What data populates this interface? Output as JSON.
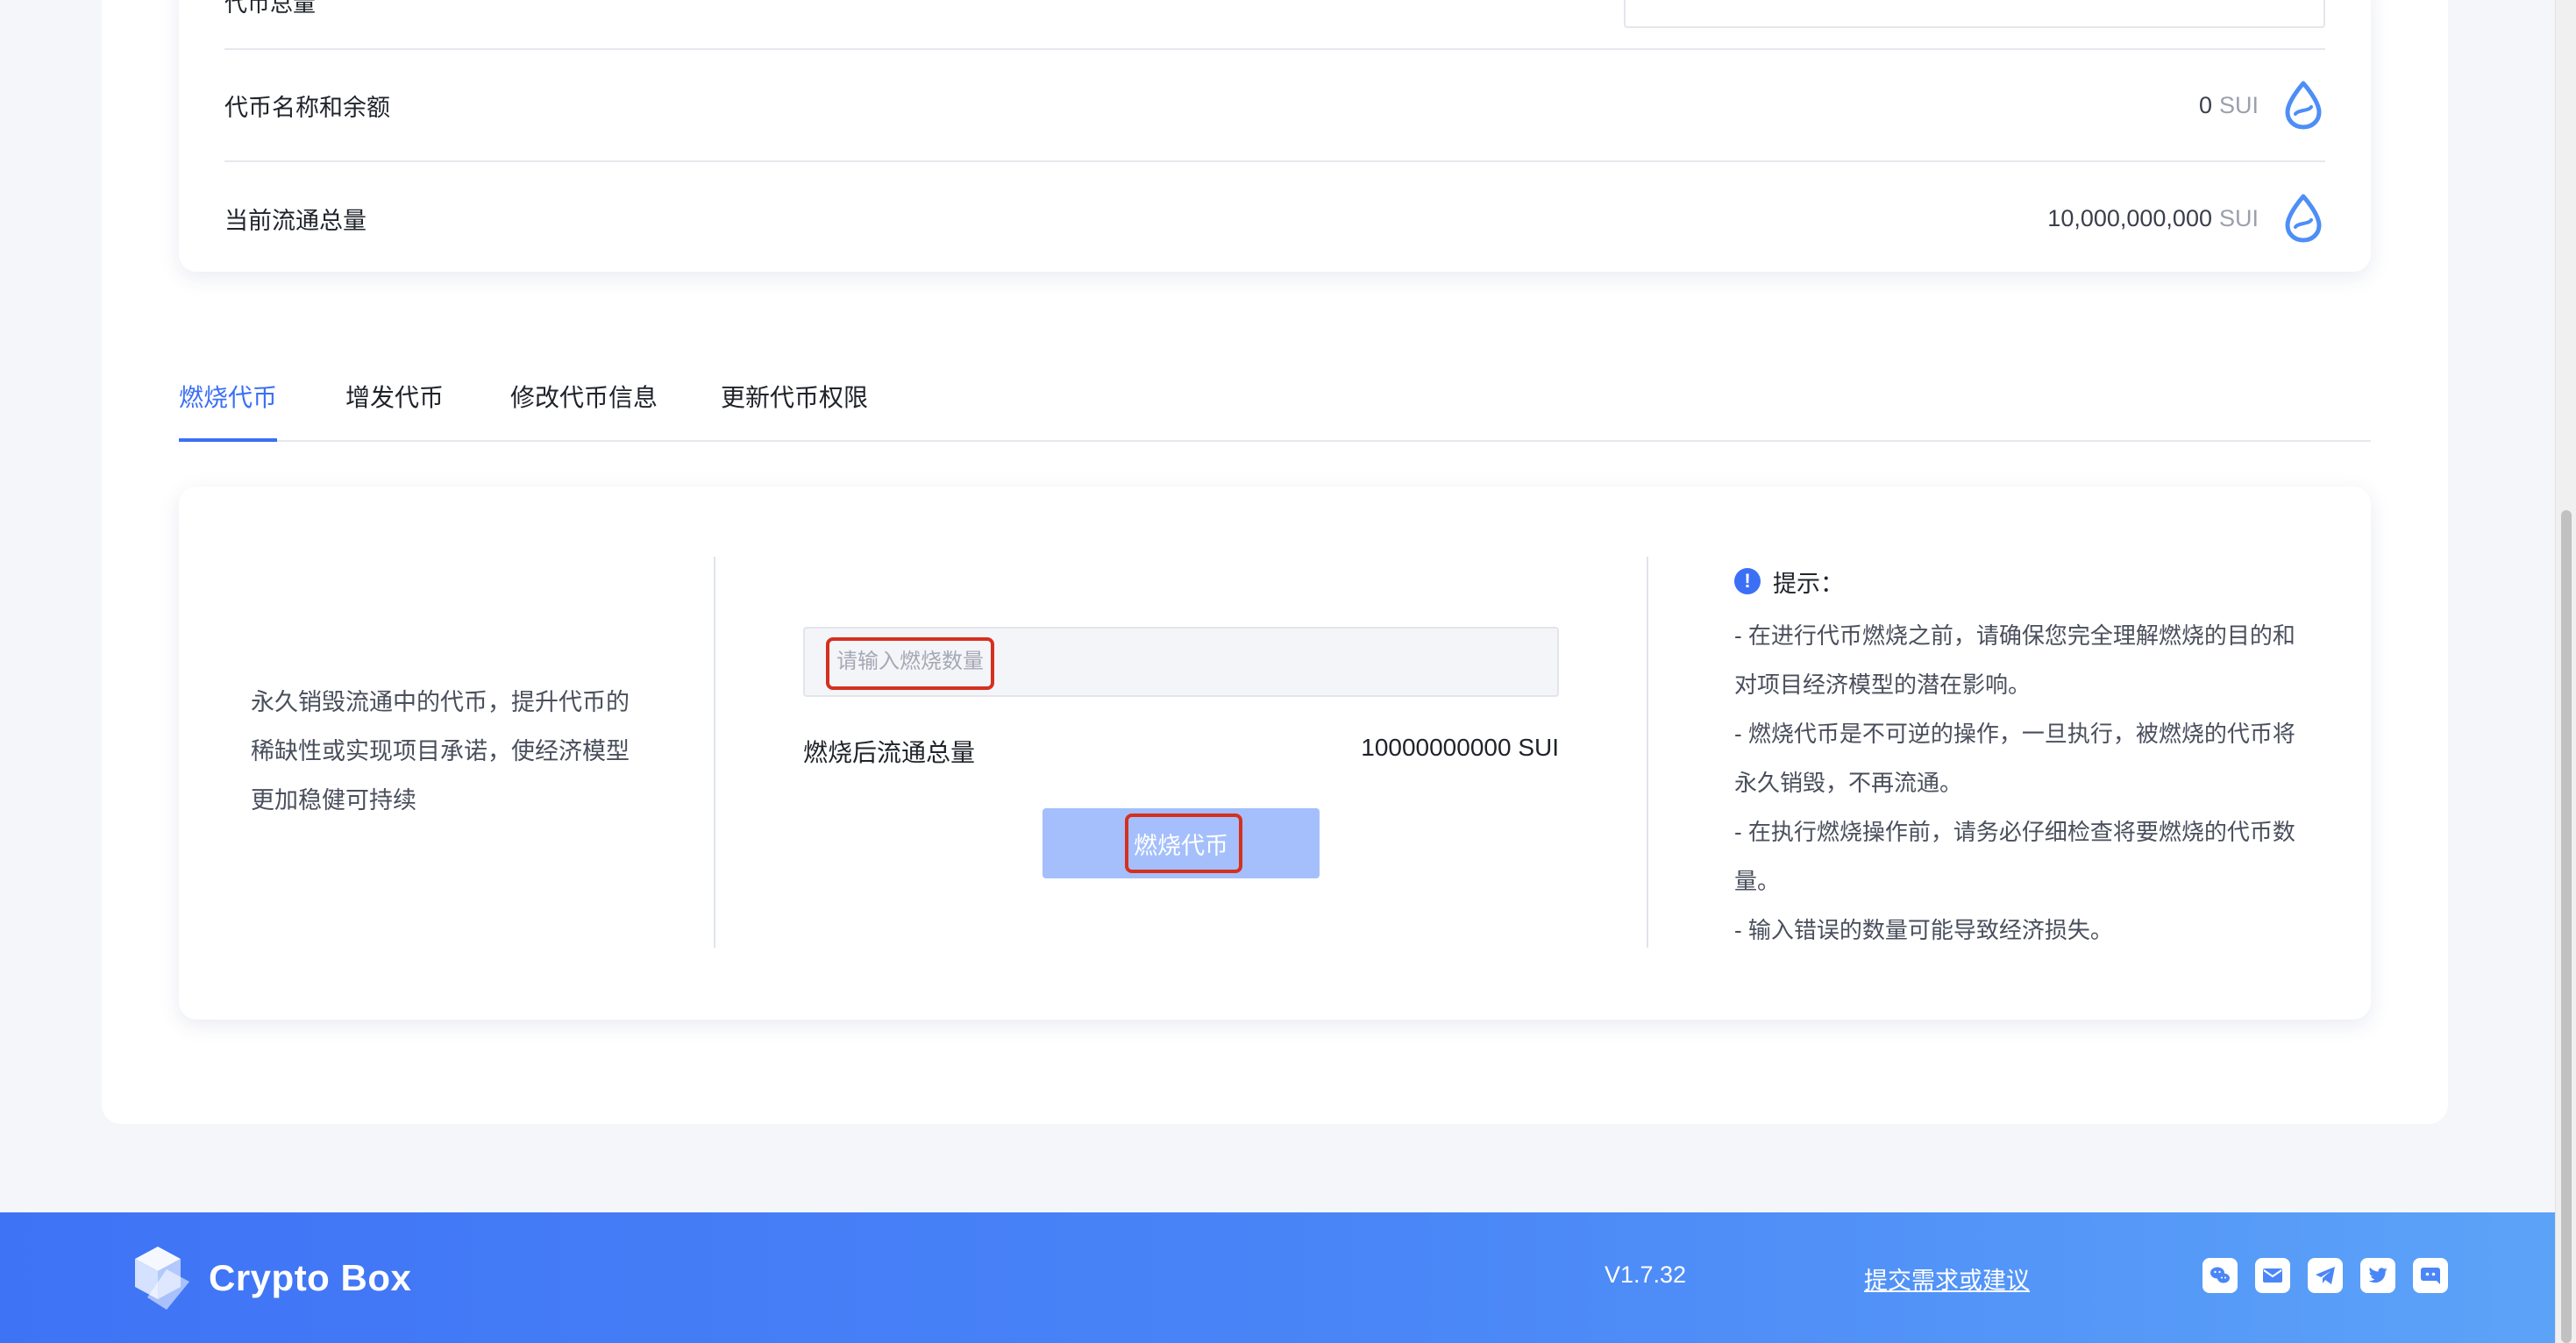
{
  "token_info": {
    "partial_row_label": "代币总量",
    "rows": [
      {
        "label": "代币名称和余额",
        "amount": "0",
        "unit": "SUI"
      },
      {
        "label": "当前流通总量",
        "amount": "10,000,000,000",
        "unit": "SUI"
      }
    ]
  },
  "tabs": [
    {
      "label": "燃烧代币"
    },
    {
      "label": "增发代币"
    },
    {
      "label": "修改代币信息"
    },
    {
      "label": "更新代币权限"
    }
  ],
  "burn_panel": {
    "description": "永久销毁流通中的代币，提升代币的稀缺性或实现项目承诺，使经济模型更加稳健可持续",
    "input_placeholder": "请输入燃烧数量",
    "after_label": "燃烧后流通总量",
    "after_value": "10000000000 SUI",
    "button_label": "燃烧代币",
    "tips_title": "提示：",
    "tips": [
      "- 在进行代币燃烧之前，请确保您完全理解燃烧的目的和对项目经济模型的潜在影响。",
      "- 燃烧代币是不可逆的操作，一旦执行，被燃烧的代币将永久销毁，不再流通。",
      "- 在执行燃烧操作前，请务必仔细检查将要燃烧的代币数量。",
      "- 输入错误的数量可能导致经济损失。"
    ]
  },
  "footer": {
    "brand": "Crypto Box",
    "version": "V1.7.32",
    "feedback_link": "提交需求或建议",
    "social_icons": [
      "wechat-icon",
      "email-icon",
      "telegram-icon",
      "twitter-icon",
      "discord-icon"
    ]
  },
  "colors": {
    "accent": "#3b6ff5",
    "button_disabled": "#a4bffb",
    "highlight_box": "#d5301f",
    "footer_start": "#3f73f6",
    "footer_end": "#5ca3f8"
  }
}
